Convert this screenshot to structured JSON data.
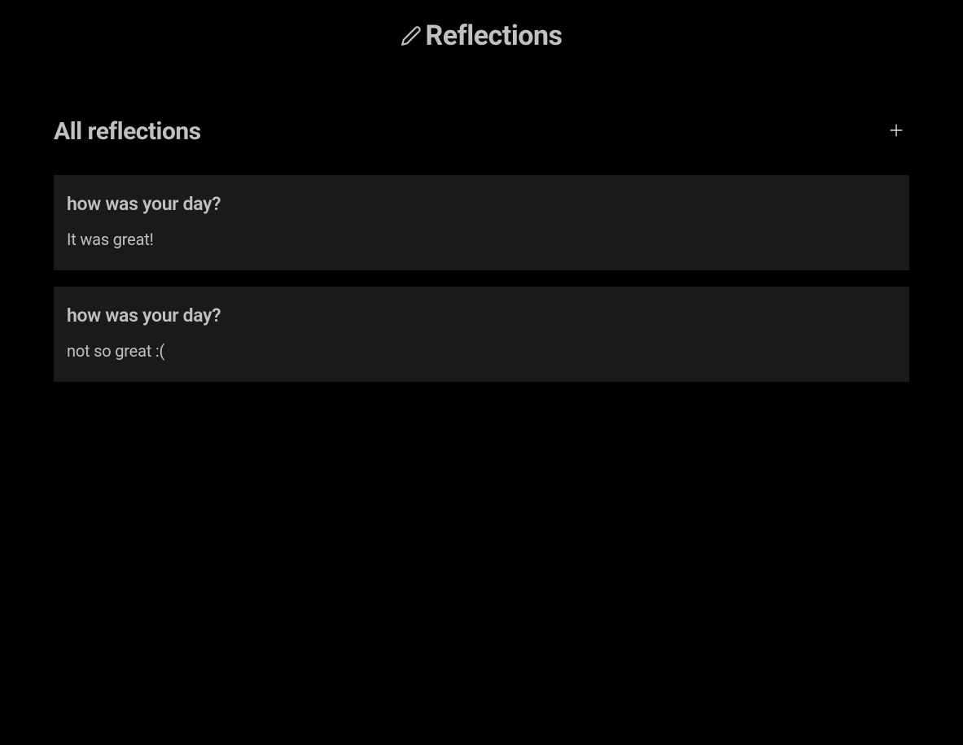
{
  "header": {
    "title": "Reflections"
  },
  "section": {
    "title": "All reflections"
  },
  "reflections": [
    {
      "question": "how was your day?",
      "answer": "It was great!"
    },
    {
      "question": "how was your day?",
      "answer": "not so great :("
    }
  ]
}
